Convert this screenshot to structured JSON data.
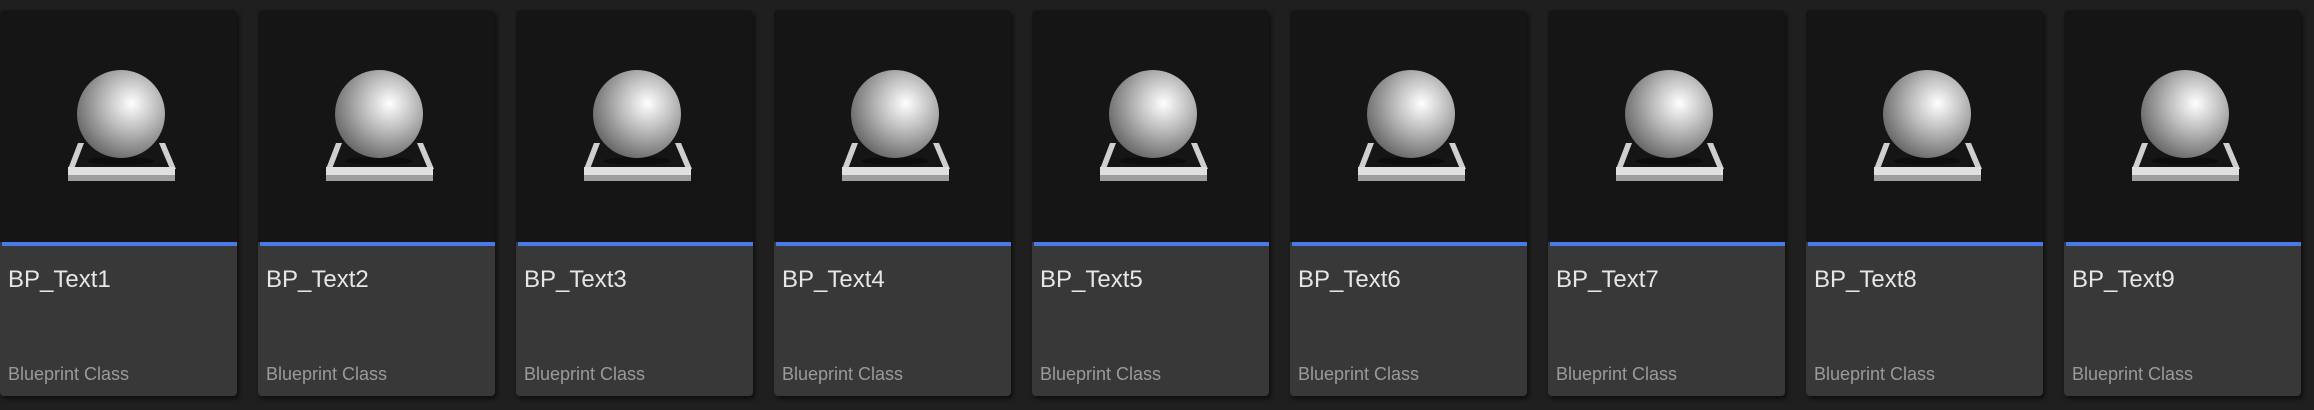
{
  "assets": [
    {
      "name": "BP_Text1",
      "type": "Blueprint Class",
      "icon": "blueprint-sphere-pedestal-icon"
    },
    {
      "name": "BP_Text2",
      "type": "Blueprint Class",
      "icon": "blueprint-sphere-pedestal-icon"
    },
    {
      "name": "BP_Text3",
      "type": "Blueprint Class",
      "icon": "blueprint-sphere-pedestal-icon"
    },
    {
      "name": "BP_Text4",
      "type": "Blueprint Class",
      "icon": "blueprint-sphere-pedestal-icon"
    },
    {
      "name": "BP_Text5",
      "type": "Blueprint Class",
      "icon": "blueprint-sphere-pedestal-icon"
    },
    {
      "name": "BP_Text6",
      "type": "Blueprint Class",
      "icon": "blueprint-sphere-pedestal-icon"
    },
    {
      "name": "BP_Text7",
      "type": "Blueprint Class",
      "icon": "blueprint-sphere-pedestal-icon"
    },
    {
      "name": "BP_Text8",
      "type": "Blueprint Class",
      "icon": "blueprint-sphere-pedestal-icon"
    },
    {
      "name": "BP_Text9",
      "type": "Blueprint Class",
      "icon": "blueprint-sphere-pedestal-icon"
    }
  ],
  "colors": {
    "background": "#1f1f1f",
    "thumbnail_background": "#151515",
    "tile_background": "#383838",
    "blueprint_type_accent": "#4a7ae8",
    "name_text": "#e6e6e6",
    "type_text": "#9a9a9a"
  }
}
